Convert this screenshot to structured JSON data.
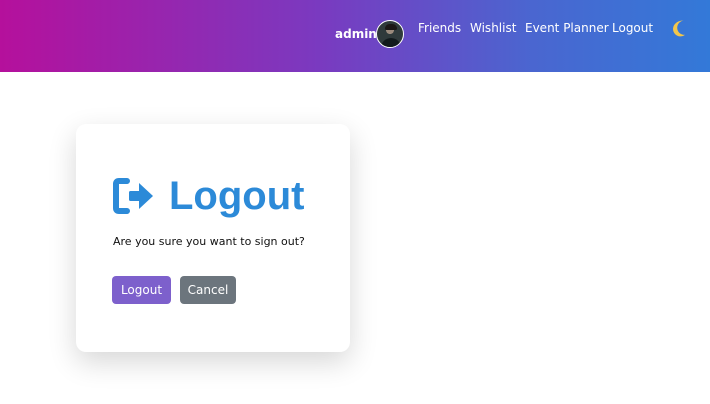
{
  "navbar": {
    "username": "admin",
    "avatar_alt": "user avatar",
    "links": [
      {
        "label": "Friends"
      },
      {
        "label": "Wishlist"
      },
      {
        "label": "Event Planner"
      },
      {
        "label": "Logout"
      }
    ],
    "theme_icon": "moon-icon",
    "gradient_colors": [
      "#b5109c",
      "#3379d8"
    ]
  },
  "card": {
    "title": "Logout",
    "title_icon": "sign-out-icon",
    "title_color": "#2c8ad8",
    "message": "Are you sure you want to sign out?",
    "buttons": {
      "confirm_label": "Logout",
      "confirm_color": "#7d60cc",
      "cancel_label": "Cancel",
      "cancel_color": "#6c757d"
    }
  }
}
